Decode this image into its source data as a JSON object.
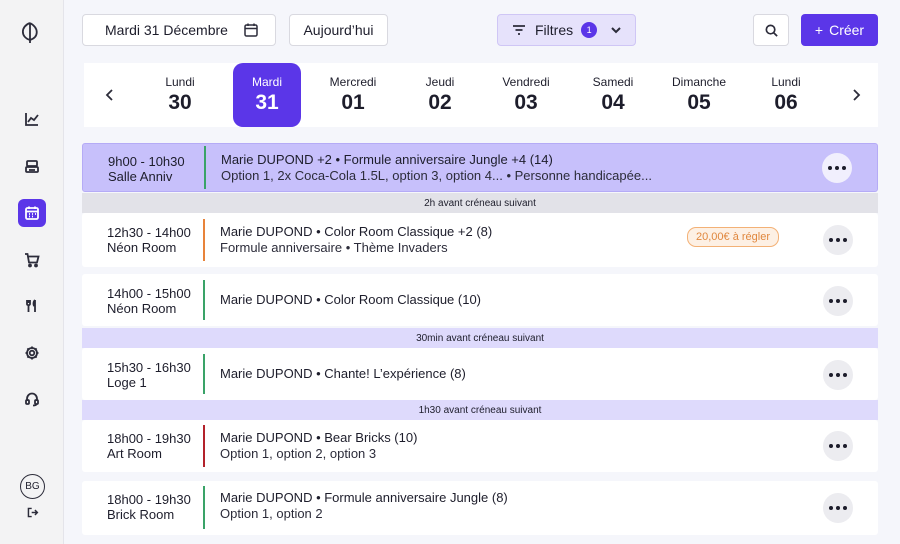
{
  "sidebar": {
    "items": [
      {
        "icon": "chart-line-icon"
      },
      {
        "icon": "printer-icon"
      },
      {
        "icon": "calendar-icon",
        "active": true
      },
      {
        "icon": "cart-icon"
      },
      {
        "icon": "fork-knife-icon"
      },
      {
        "icon": "gear-icon"
      },
      {
        "icon": "headset-icon"
      }
    ],
    "avatar_initials": "BG"
  },
  "toolbar": {
    "date_label": "Mardi 31 Décembre",
    "today_label": "Aujourd’hui",
    "filters_label": "Filtres",
    "filters_count": "1",
    "create_label": "Créer",
    "create_plus": "+"
  },
  "days": [
    {
      "name": "Lundi",
      "num": "30"
    },
    {
      "name": "Mardi",
      "num": "31",
      "selected": true
    },
    {
      "name": "Mercredi",
      "num": "01"
    },
    {
      "name": "Jeudi",
      "num": "02"
    },
    {
      "name": "Vendredi",
      "num": "03"
    },
    {
      "name": "Samedi",
      "num": "04"
    },
    {
      "name": "Dimanche",
      "num": "05"
    },
    {
      "name": "Lundi",
      "num": "06"
    }
  ],
  "bookings": [
    {
      "time": "9h00 - 10h30",
      "room": "Salle Anniv",
      "title": "Marie DUPOND +2 • Formule anniversaire Jungle +4 (14)",
      "subtitle": "Option 1, 2x Coca-Cola 1.5L, option 3, option 4... • Personne handicapée...",
      "bar_color": "#3aa368",
      "highlight": true
    },
    {
      "time": "12h30 - 14h00",
      "room": "Néon Room",
      "title": "Marie DUPOND • Color Room Classique +2 (8)",
      "subtitle": "Formule anniversaire • Thème Invaders",
      "bar_color": "#e8833a",
      "badge": "20,00€ à régler"
    },
    {
      "time": "14h00 - 15h00",
      "room": "Néon Room",
      "title": "Marie DUPOND • Color Room Classique (10)",
      "subtitle": "",
      "bar_color": "#3aa368"
    },
    {
      "time": "15h30 - 16h30",
      "room": "Loge 1",
      "title": "Marie DUPOND • Chante! L’expérience (8)",
      "subtitle": "",
      "bar_color": "#3aa368"
    },
    {
      "time": "18h00 - 19h30",
      "room": "Art Room",
      "title": "Marie DUPOND • Bear Bricks (10)",
      "subtitle": "Option 1, option 2, option 3",
      "bar_color": "#b3222b"
    },
    {
      "time": "18h00 - 19h30",
      "room": "Brick Room",
      "title": "Marie DUPOND • Formule anniversaire Jungle (8)",
      "subtitle": "Option 1, option 2",
      "bar_color": "#3aa368"
    }
  ],
  "gaps": [
    {
      "label": "2h avant créneau suivant",
      "color": "#e2e2e8"
    },
    {
      "label": "30min avant créneau suivant",
      "color": "#dedafc"
    },
    {
      "label": "1h30 avant créneau suivant",
      "color": "#dedafc"
    }
  ]
}
